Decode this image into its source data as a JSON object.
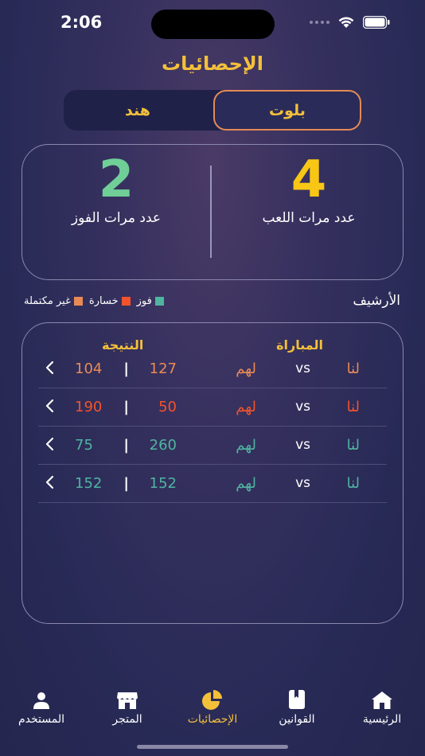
{
  "status": {
    "time": "2:06"
  },
  "header": {
    "title": "الإحصائيات"
  },
  "tabs": {
    "active_label": "بلوت",
    "inactive_label": "هند"
  },
  "summary": {
    "games_played_value": "4",
    "games_played_label": "عدد مرات اللعب",
    "wins_value": "2",
    "wins_label": "عدد مرات الفوز"
  },
  "archive": {
    "title": "الأرشيف",
    "legend": [
      {
        "label": "فوز",
        "color": "#4fb5a0"
      },
      {
        "label": "خسارة",
        "color": "#f3532b"
      },
      {
        "label": "غير مكتملة",
        "color": "#e98a56"
      }
    ]
  },
  "history": {
    "match_header": "المباراة",
    "result_header": "النتيجة",
    "rows": [
      {
        "us": "لنا",
        "vs": "vs",
        "them": "لهم",
        "score_us": "127",
        "sep": "|",
        "score_them": "104",
        "status": "incomplete"
      },
      {
        "us": "لنا",
        "vs": "vs",
        "them": "لهم",
        "score_us": "50",
        "sep": "|",
        "score_them": "190",
        "status": "loss"
      },
      {
        "us": "لنا",
        "vs": "vs",
        "them": "لهم",
        "score_us": "260",
        "sep": "|",
        "score_them": "75",
        "status": "win"
      },
      {
        "us": "لنا",
        "vs": "vs",
        "them": "لهم",
        "score_us": "152",
        "sep": "|",
        "score_them": "152",
        "status": "win"
      }
    ]
  },
  "tabbar": {
    "home": "الرئيسية",
    "rules": "القوانين",
    "stats": "الإحصائيات",
    "store": "المتجر",
    "user": "المستخدم"
  },
  "colors": {
    "accent": "#f4c03a",
    "win": "#4fb5a0",
    "loss": "#f3532b",
    "incomplete": "#e98a56"
  }
}
